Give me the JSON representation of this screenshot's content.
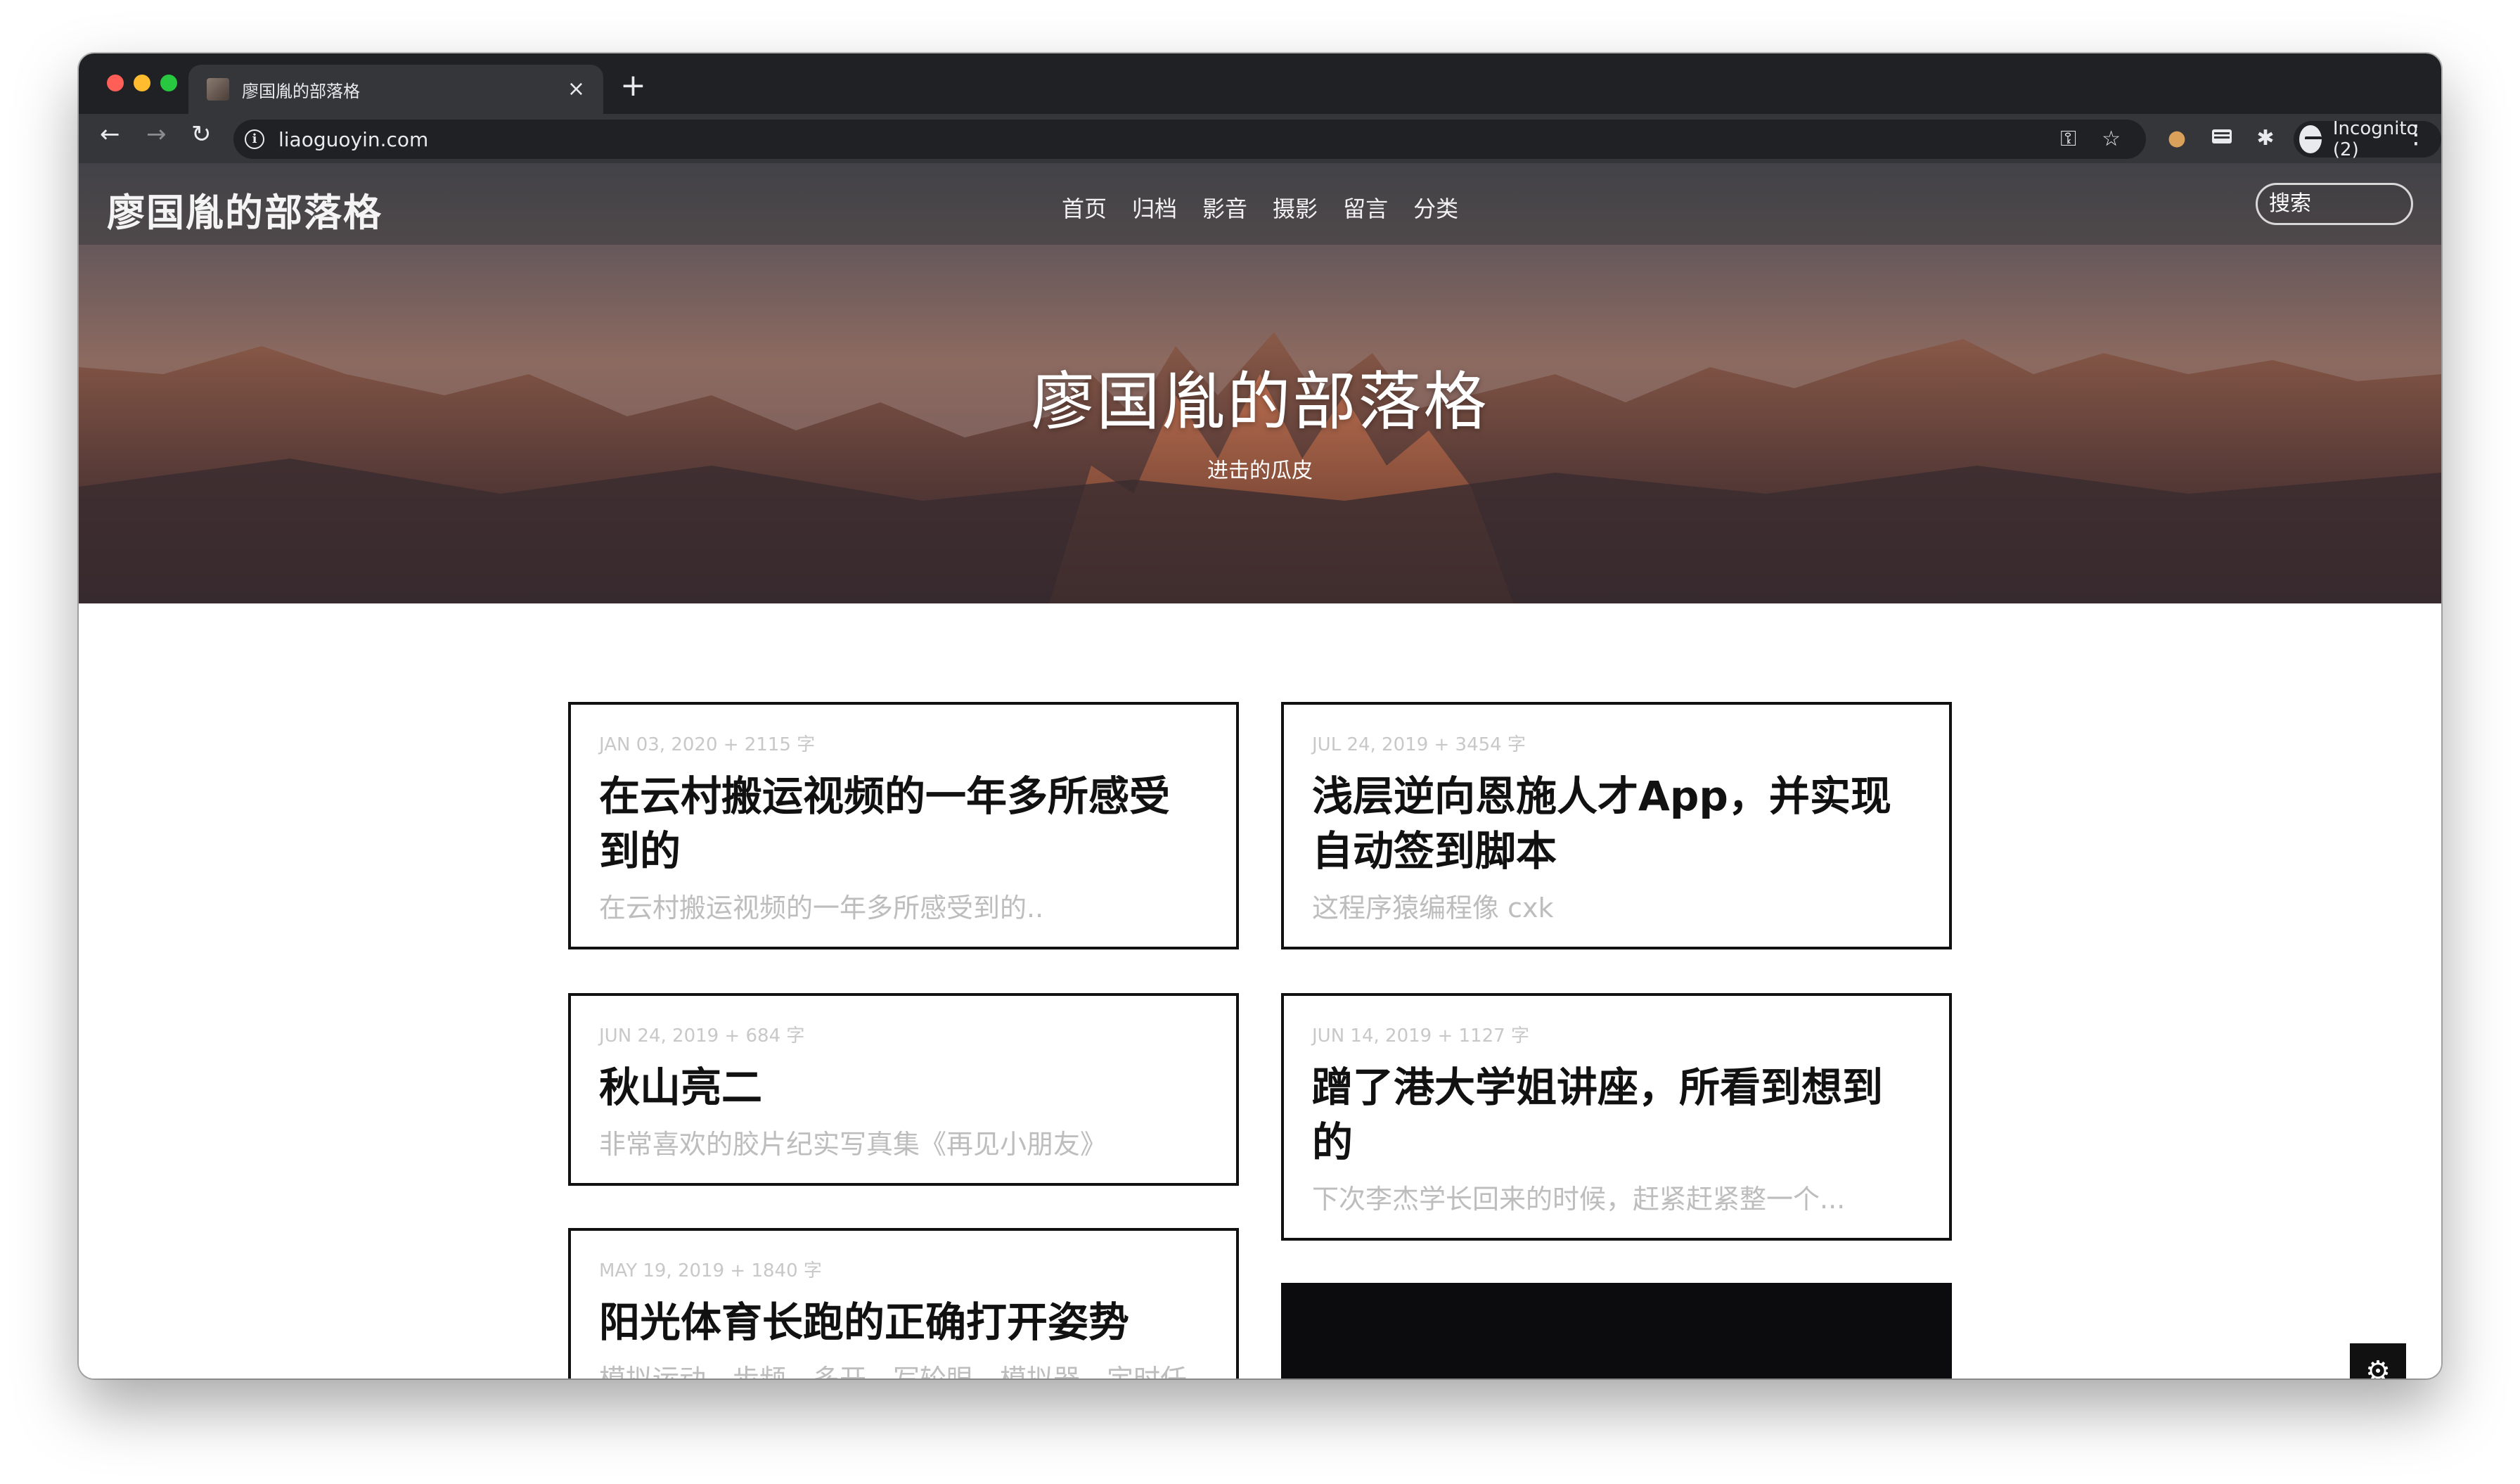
{
  "browser": {
    "tab_title": "廖国胤的部落格",
    "tab_close": "×",
    "new_tab": "+",
    "url": "liaoguoyin.com",
    "incognito_label": "Incognito (2)"
  },
  "site": {
    "brand": "廖国胤的部落格",
    "nav": [
      "首页",
      "归档",
      "影音",
      "摄影",
      "留言",
      "分类"
    ],
    "search_placeholder": "搜索",
    "hero_title": "廖国胤的部落格",
    "hero_subtitle": "进击的瓜皮"
  },
  "posts": [
    {
      "meta": "JAN 03, 2020 + 2115 字",
      "title": "在云村搬运视频的一年多所感受到的",
      "excerpt": "在云村搬运视频的一年多所感受到的.."
    },
    {
      "meta": "JUL 24, 2019 + 3454 字",
      "title": "浅层逆向恩施人才App，并实现自动签到脚本",
      "excerpt": "这程序猿编程像 cxk"
    },
    {
      "meta": "JUN 24, 2019 + 684 字",
      "title": "秋山亮二",
      "excerpt": "非常喜欢的胶片纪实写真集《再见小朋友》"
    },
    {
      "meta": "JUN 14, 2019 + 1127 字",
      "title": "蹭了港大学姐讲座，所看到想到的",
      "excerpt": "下次李杰学长回来的时候，赶紧赶紧整一个..."
    },
    {
      "meta": "MAY 19, 2019 + 1840 字",
      "title": "阳光体育长跑的正确打开姿势",
      "excerpt": "模拟运动、步频、多开、写轮眼、模拟器、定时任务、Aipao 脚本.."
    }
  ],
  "icons": {
    "back": "back-arrow-icon",
    "forward": "forward-arrow-icon",
    "reload": "reload-icon",
    "info": "site-info-icon",
    "key": "password-key-icon",
    "star": "bookmark-star-icon",
    "cookie": "cookie-extension-icon",
    "card_ext": "card-extension-icon",
    "puzzle": "extensions-puzzle-icon",
    "incognito": "incognito-icon",
    "menu": "more-menu-icon",
    "gear": "settings-gear-icon"
  },
  "colors": {
    "chrome_dark": "#202124",
    "toolbar": "#35363a",
    "card_border": "#111111",
    "meta_gray": "#c8c8c8"
  }
}
